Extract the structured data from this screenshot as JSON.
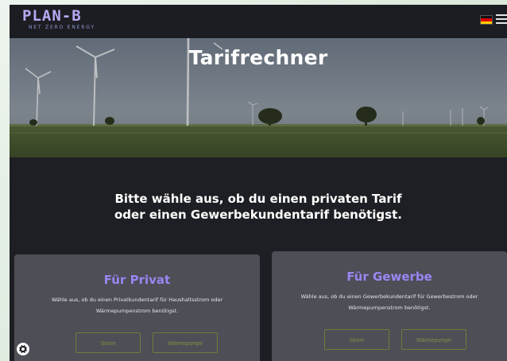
{
  "header": {
    "logo_main": "PLAN-B",
    "logo_sub": "NET ZERO ENERGY",
    "flag_icon": "german-flag-icon",
    "menu_icon": "hamburger-menu-icon"
  },
  "hero": {
    "title": "Tarifrechner"
  },
  "intro": {
    "line1": "Bitte wähle aus, ob du einen privaten Tarif",
    "line2": "oder einen Gewerbekundentarif benötigst."
  },
  "cards": {
    "privat": {
      "title": "Für Privat",
      "desc1": "Wähle aus, ob du einen Privatkundentarif für Haushaltsstrom oder",
      "desc2": "Wärmepumpenstrom benötigst.",
      "btn_strom": "Strom",
      "btn_waermepumpe": "Wärmepumpe"
    },
    "gewerbe": {
      "title": "Für Gewerbe",
      "desc1": "Wähle aus, ob du einen Gewerbekundentarif für Gewerbestrom oder",
      "desc2": "Wärmepumpenstrom benötigst.",
      "btn_strom": "Strom",
      "btn_waermepumpe": "Wärmepumpe"
    }
  },
  "cookie_icon": "cookie-settings-icon",
  "colors": {
    "page_bg": "#1e1f24",
    "card_bg": "#4d4e56",
    "accent_purple": "#9a86f2",
    "button_green": "#7e9340",
    "logo_color": "#b7a8f3"
  }
}
